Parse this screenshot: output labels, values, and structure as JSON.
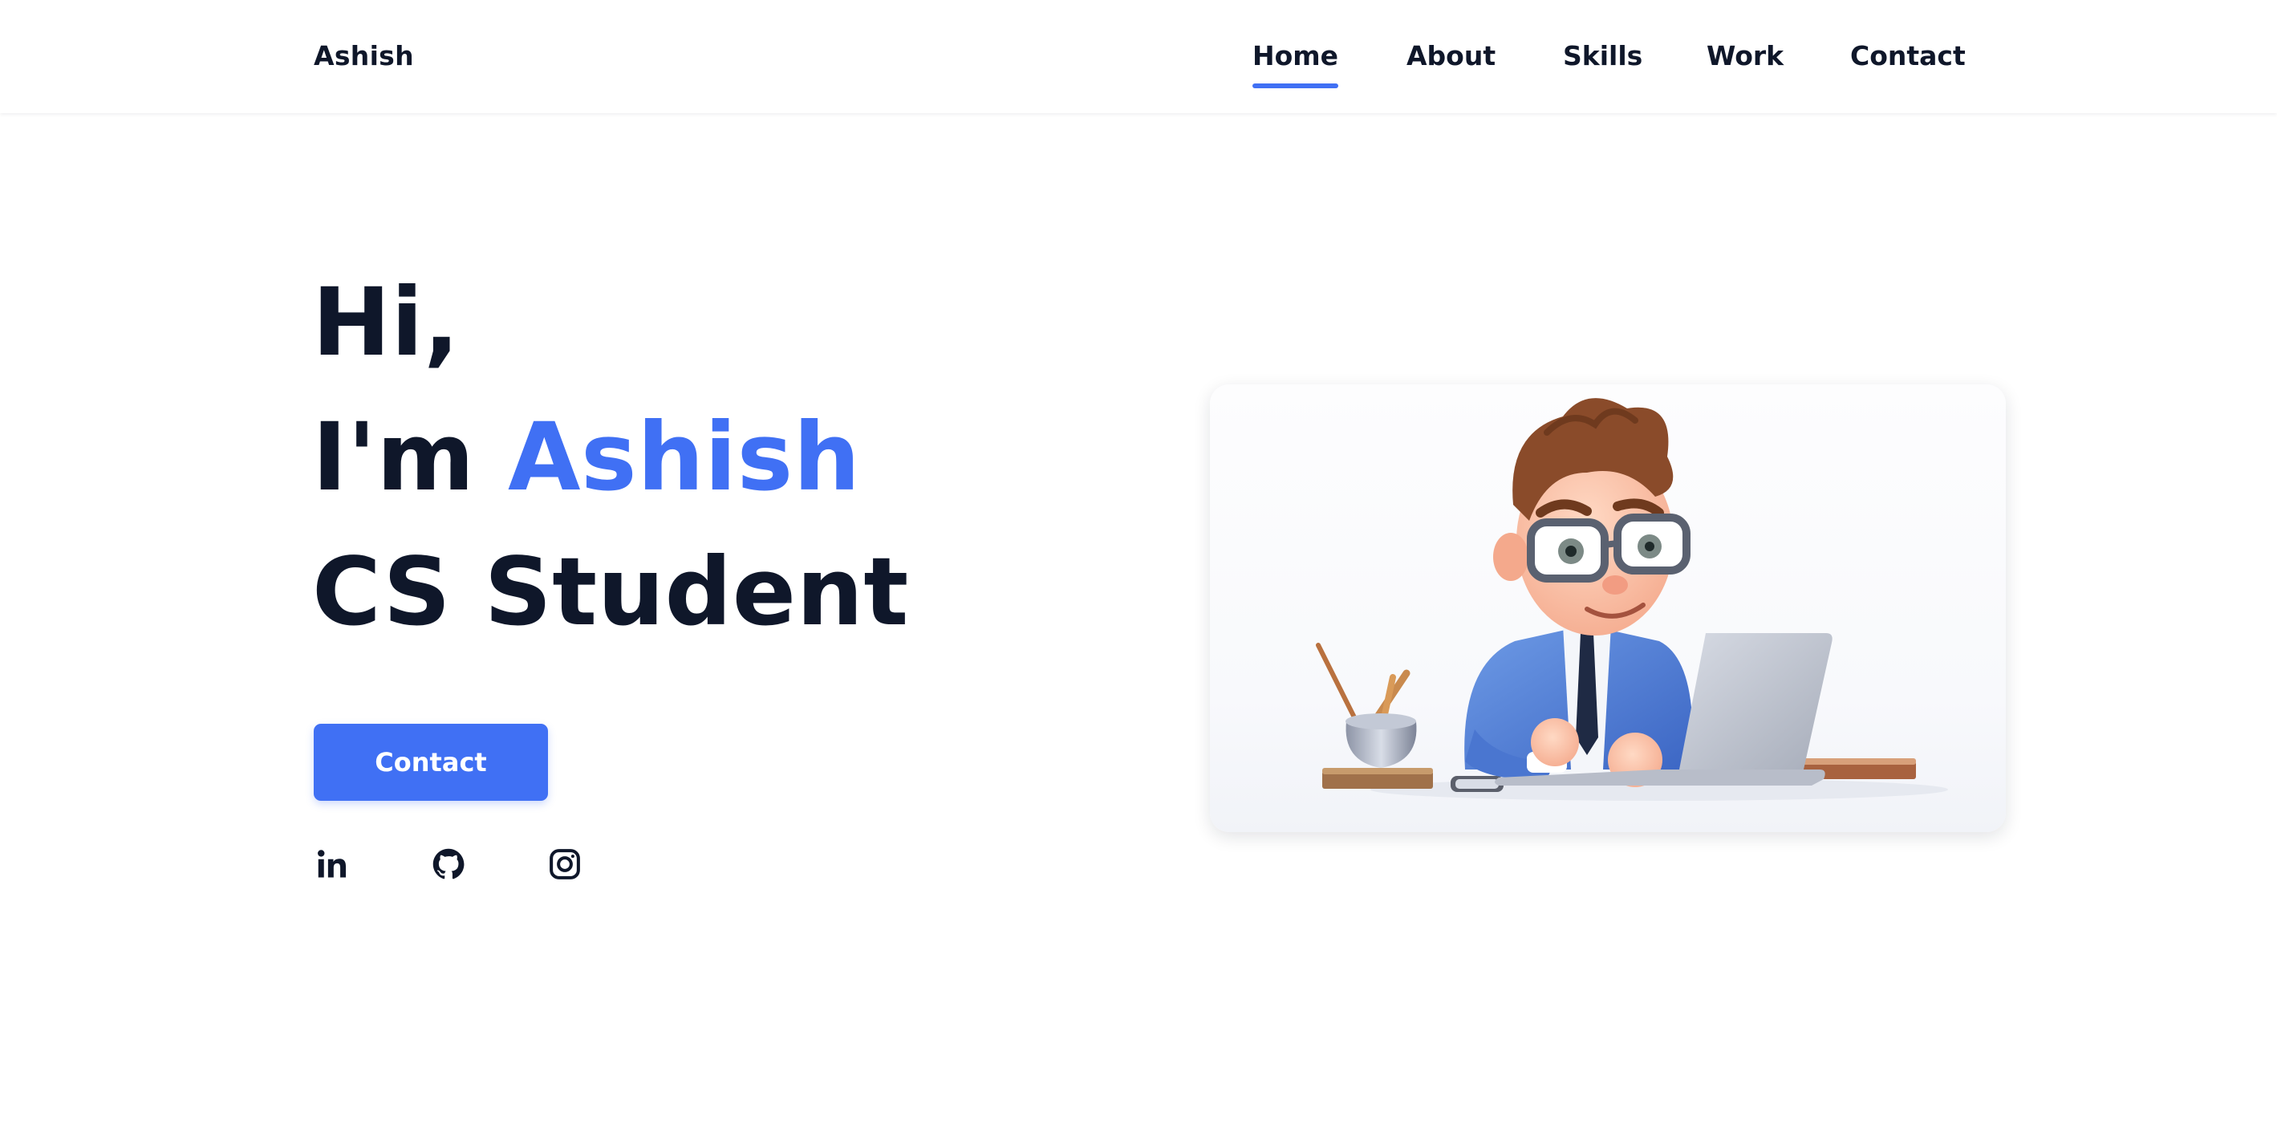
{
  "header": {
    "logo": "Ashish",
    "nav": [
      {
        "label": "Home",
        "active": true
      },
      {
        "label": "About",
        "active": false
      },
      {
        "label": "Skills",
        "active": false
      },
      {
        "label": "Work",
        "active": false
      },
      {
        "label": "Contact",
        "active": false
      }
    ]
  },
  "hero": {
    "greeting": "Hi,",
    "intro_prefix": "I'm",
    "name": "Ashish",
    "role": "CS Student",
    "cta_label": "Contact",
    "social": [
      {
        "name": "linkedin-icon",
        "label": "in"
      },
      {
        "name": "github-icon"
      },
      {
        "name": "instagram-icon"
      }
    ],
    "illustration": "cartoon-student-with-laptop"
  },
  "colors": {
    "accent": "#4070f4",
    "text": "#0f172a",
    "background": "#ffffff"
  }
}
